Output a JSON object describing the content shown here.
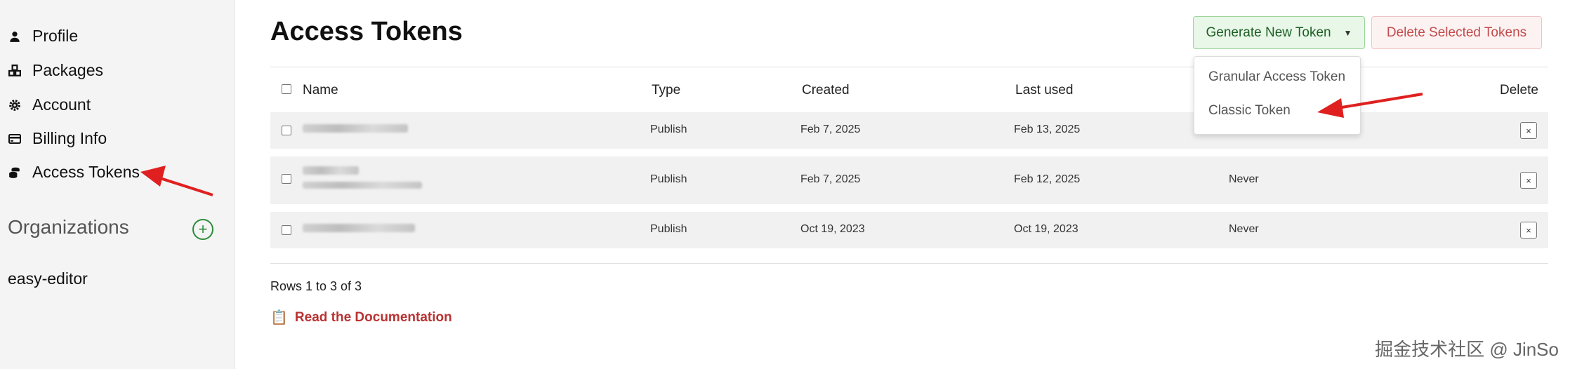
{
  "sidebar": {
    "items": [
      {
        "label": "Profile",
        "icon": "user-icon"
      },
      {
        "label": "Packages",
        "icon": "packages-icon"
      },
      {
        "label": "Account",
        "icon": "gear-icon"
      },
      {
        "label": "Billing Info",
        "icon": "credit-card-icon"
      },
      {
        "label": "Access Tokens",
        "icon": "coins-icon"
      }
    ],
    "organizations_title": "Organizations",
    "add_org_symbol": "+",
    "org": "easy-editor"
  },
  "main": {
    "title": "Access Tokens",
    "generate_label": "Generate New Token",
    "delete_selected_label": "Delete Selected Tokens",
    "dropdown": [
      "Granular Access Token",
      "Classic Token"
    ],
    "table": {
      "columns": [
        "Name",
        "Type",
        "Created",
        "Last used",
        "Delete"
      ],
      "rows": [
        {
          "type": "Publish",
          "created": "Feb 7, 2025",
          "last_used": "Feb 13, 2025",
          "expires": "",
          "delete": "×"
        },
        {
          "type": "Publish",
          "created": "Feb 7, 2025",
          "last_used": "Feb 12, 2025",
          "expires": "Never",
          "delete": "×"
        },
        {
          "type": "Publish",
          "created": "Oct 19, 2023",
          "last_used": "Oct 19, 2023",
          "expires": "Never",
          "delete": "×"
        }
      ]
    },
    "rows_info": "Rows 1 to 3 of 3",
    "doc_link": "Read the Documentation",
    "doc_icon": "clipboard-icon"
  },
  "watermark": "掘金技术社区 @ JinSo",
  "colors": {
    "accent_green": "#1d5f23",
    "danger_red": "#c24b4b",
    "link_red": "#b83232",
    "annotation_arrow": "#e02020"
  }
}
